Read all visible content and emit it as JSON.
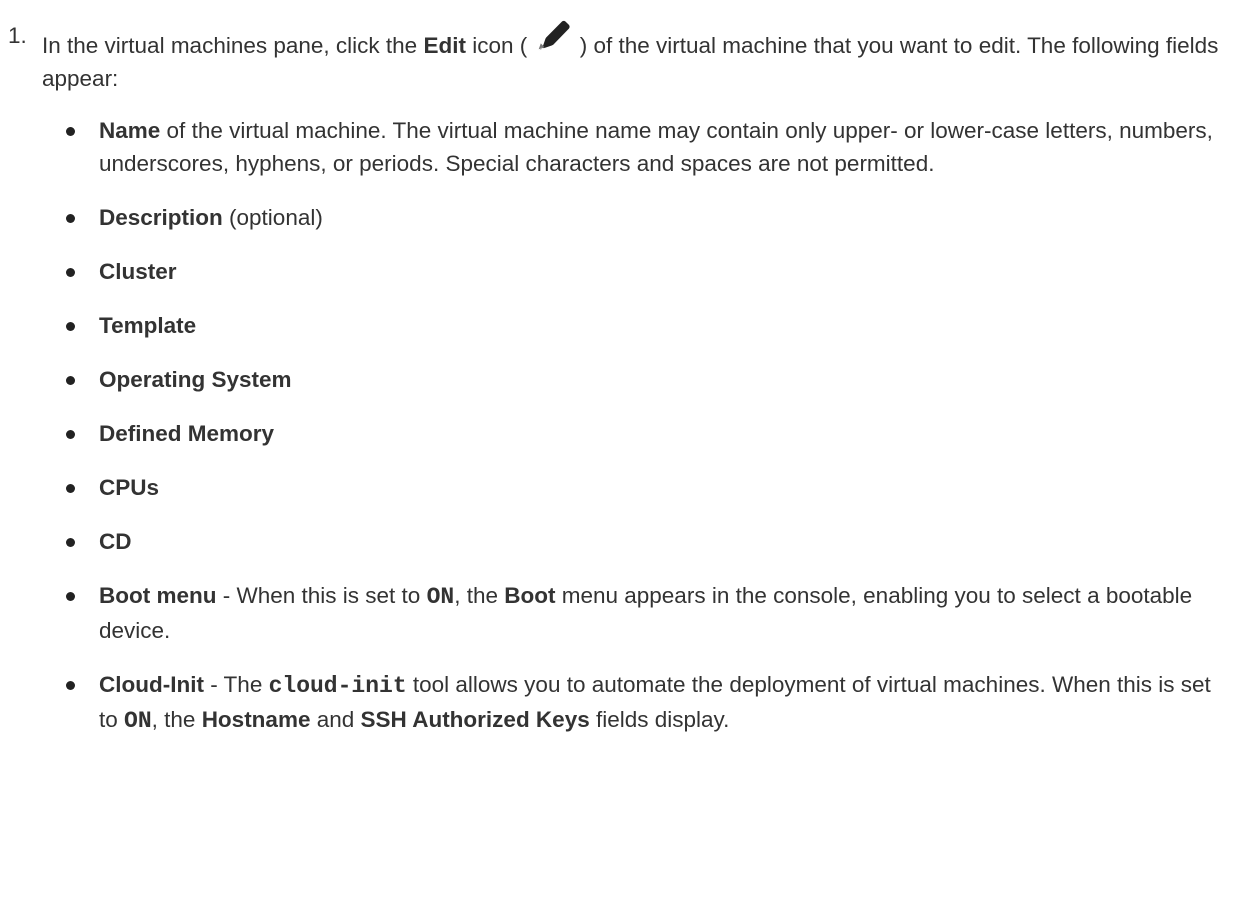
{
  "step": {
    "number": "1.",
    "text_before_edit": "In the virtual machines pane, click the ",
    "edit_label": "Edit",
    "text_icon_open": " icon ( ",
    "icon": "pencil-icon",
    "text_icon_close": " ) of the virtual machine that you want to edit. The following fields appear:"
  },
  "fields": [
    {
      "name": "Name",
      "text": " of the virtual machine. The virtual machine name may contain only upper- or lower-case letters, numbers, underscores, hyphens, or periods. Special characters and spaces are not permitted."
    },
    {
      "name": "Description",
      "text": " (optional)"
    },
    {
      "name": "Cluster"
    },
    {
      "name": "Template"
    },
    {
      "name": "Operating System"
    },
    {
      "name": "Defined Memory"
    },
    {
      "name": "CPUs"
    },
    {
      "name": "CD"
    },
    {
      "name": "Boot menu",
      "text_1": " - When this is set to ",
      "code_1": "ON",
      "text_2": ", the ",
      "bold_1": "Boot",
      "text_3": " menu appears in the console, enabling you to select a bootable device."
    },
    {
      "name": "Cloud-Init",
      "text_1": " - The ",
      "code_1": "cloud-init",
      "text_2": " tool allows you to automate the deployment of virtual machines. When this is set to ",
      "code_2": "ON",
      "text_3": ", the ",
      "bold_1": "Hostname",
      "text_4": " and ",
      "bold_2": "SSH Authorized Keys",
      "text_5": " fields display."
    }
  ]
}
